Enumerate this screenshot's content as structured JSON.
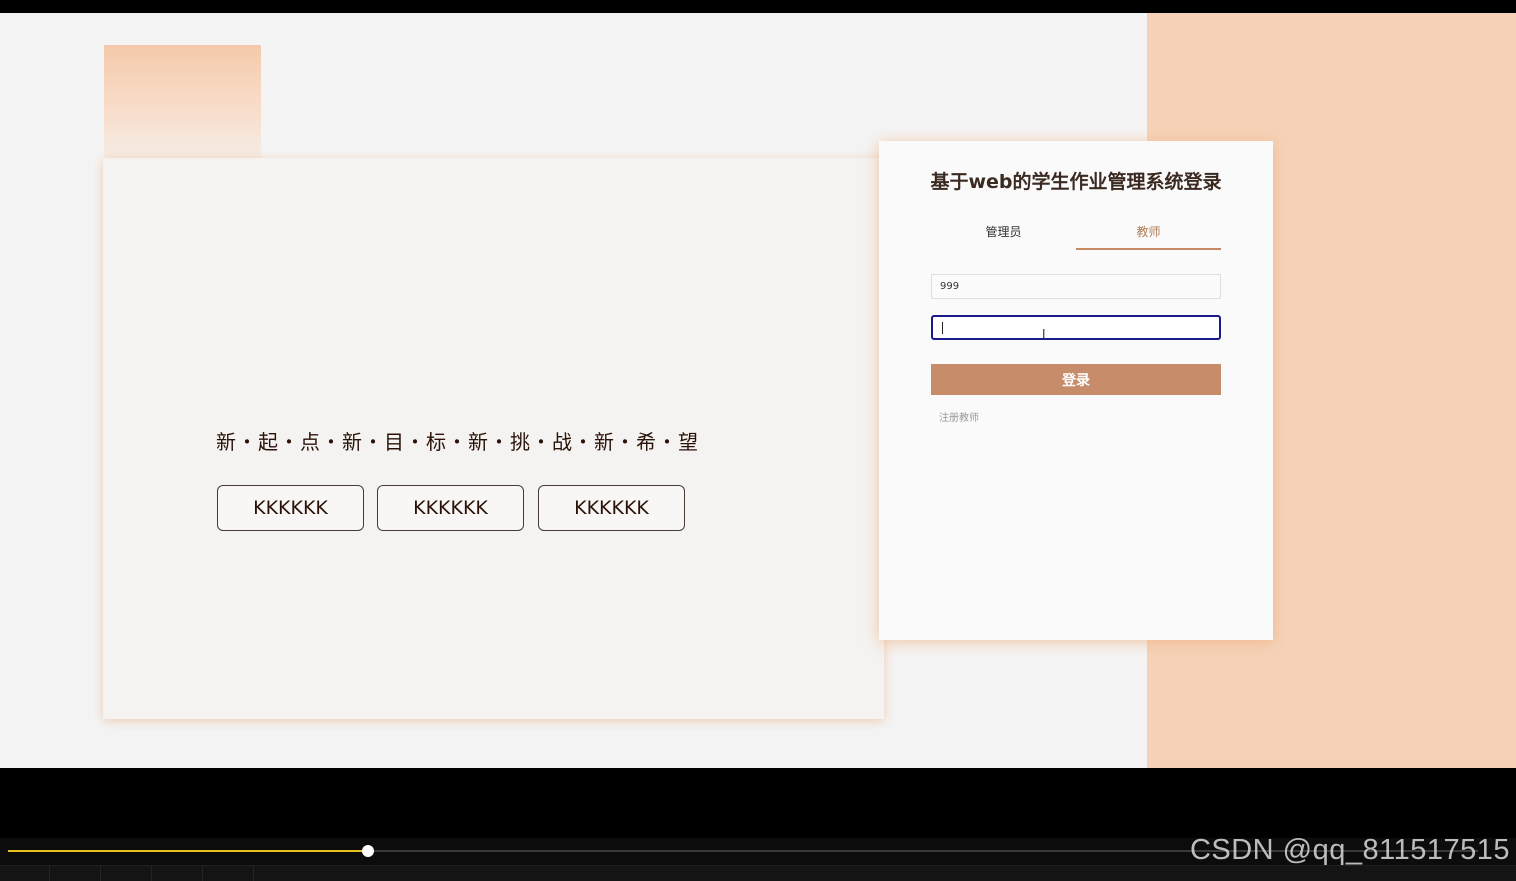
{
  "hero": {
    "slogan": "新・起・点・新・目・标・新・挑・战・新・希・望",
    "buttons": [
      "KKKKKK",
      "KKKKKK",
      "KKKKKK"
    ]
  },
  "login": {
    "title": "基于web的学生作业管理系统登录",
    "tabs": [
      {
        "label": "管理员",
        "active": false
      },
      {
        "label": "教师",
        "active": true
      }
    ],
    "username_value": "999",
    "password_value": "",
    "submit_label": "登录",
    "register_link": "注册教师"
  },
  "player": {
    "progress": 0.245
  },
  "watermark": "CSDN @qq_811517515",
  "colors": {
    "accent": "#c78c69",
    "peach": "#f5d2b8",
    "active_tab": "#b07a55",
    "progress": "#e6c21c"
  }
}
